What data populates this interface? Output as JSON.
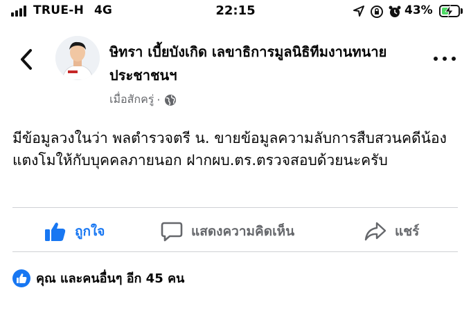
{
  "status_bar": {
    "carrier": "TRUE-H",
    "network": "4G",
    "time": "22:15",
    "battery_percent": "43%",
    "battery_level": 0.43,
    "icons": [
      "location-arrow-icon",
      "orientation-lock-icon",
      "alarm-icon"
    ]
  },
  "post": {
    "author": "ษิทรา เบี้ยบังเกิด เลขาธิการมูลนิธิทีมงานทนายประชาชนฯ",
    "timestamp": "เมื่อสักครู่",
    "separator": "·",
    "body": "มีข้อมูลวงในว่า พลตำรวจตรี น. ขายข้อมูลความลับการสืบสวนคดีน้องแตงโมให้กับบุคคลภายนอก ฝากผบ.ตร.ตรวจสอบด้วยนะครับ"
  },
  "actions": {
    "like": "ถูกใจ",
    "comment": "แสดงความคิดเห็น",
    "share": "แชร์"
  },
  "reactions": {
    "summary": "คุณ และคนอื่นๆ อีก 45 คน"
  },
  "colors": {
    "facebook_blue": "#1877f2",
    "secondary_text": "#65676b",
    "battery_green": "#4cd964"
  }
}
